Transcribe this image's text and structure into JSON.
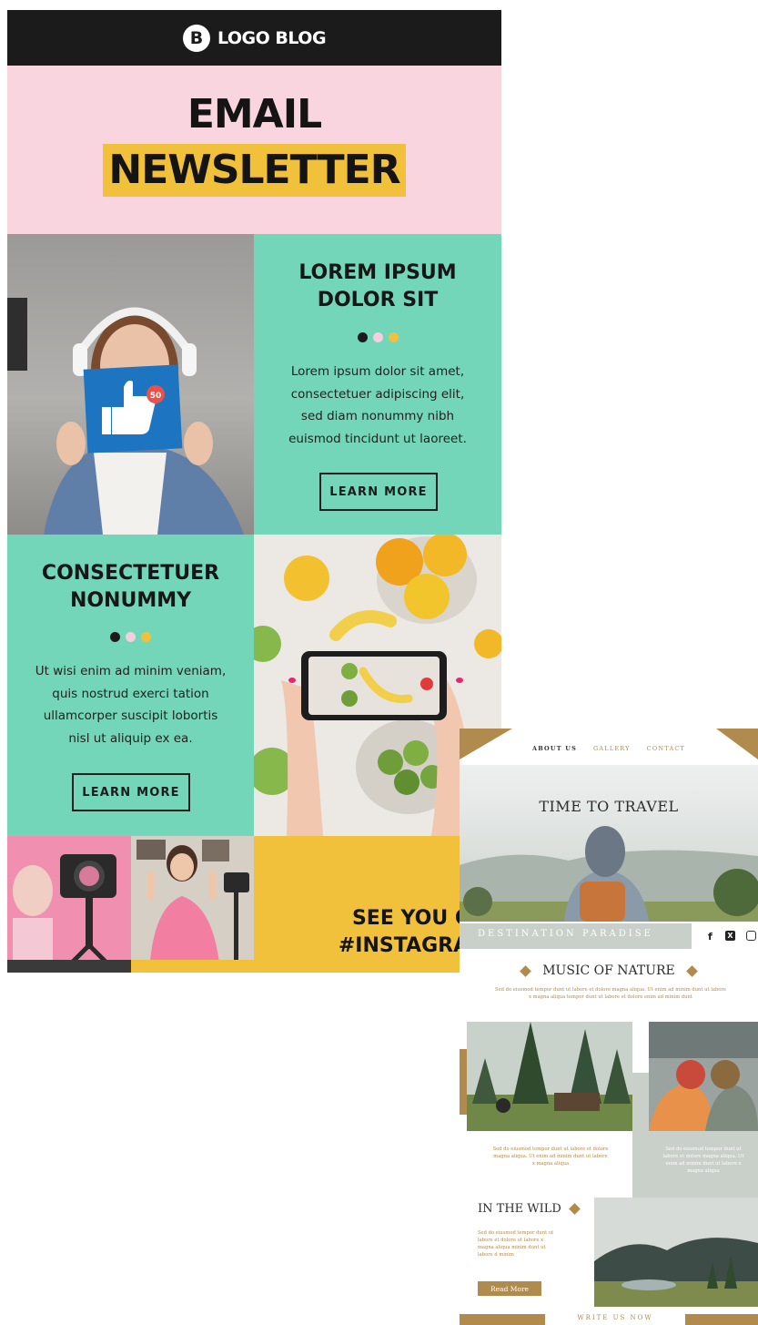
{
  "newsletter1": {
    "logo": {
      "badge": "B",
      "text": "LOGO BLOG"
    },
    "hero": {
      "line1": "EMAIL",
      "line2": "NEWSLETTER"
    },
    "block1": {
      "title_line1": "LOREM IPSUM",
      "title_line2": "DOLOR SIT",
      "body": [
        "Lorem ipsum dolor sit amet,",
        "consectetuer adipiscing elit,",
        "sed diam nonummy nibh",
        "euismod tincidunt ut laoreet."
      ],
      "button": "LEARN MORE",
      "badge_count": "50"
    },
    "block2": {
      "title_line1": "CONSECTETUER",
      "title_line2": "NONUMMY",
      "body": [
        "Ut wisi enim ad minim veniam,",
        "quis nostrud exerci tation",
        "ullamcorper suscipit lobortis",
        "nisl ut aliquip ex ea."
      ],
      "button": "LEARN MORE"
    },
    "footer": {
      "line1": "SEE YOU ON",
      "line2": "#INSTAGRAM"
    },
    "colors": {
      "dark": "#1b1b1b",
      "pink": "#f9d6df",
      "teal": "#74d6b8",
      "yellow": "#f2c13c",
      "dot_pink": "#f3d0dc"
    }
  },
  "newsletter2": {
    "nav": [
      "ABOUT US",
      "GALLERY",
      "CONTACT"
    ],
    "title": "TIME TO TRAVEL",
    "destination": "DESTINATION PARADISE",
    "social_icons": [
      "facebook-icon",
      "x-icon",
      "instagram-icon"
    ],
    "section1": {
      "title": "MUSIC OF NATURE",
      "text_line1": "Sed do eiusmod tempor dunt ut labore et dolore magna aliqua. Ut enim ad minim dunt ut labore",
      "text_line2": "x magna aliqua tempor dunt ut labore et dolore enim ad minim dunt"
    },
    "caption_left": [
      "Sed do eiusmod tempor dunt ut labore et dolore",
      "magna aliqua. Ut enim ad minim dunt ut labore",
      "x magna aliqua"
    ],
    "caption_right": [
      "Sed do eiusmod tempor dunt ut",
      "labore et dolore magna aliqua. Ut",
      "enim ad minim dunt ut labore x",
      "magna aliqua"
    ],
    "section2": {
      "title": "IN THE WILD",
      "text": [
        "Sed do eiusmod tempor dunt ut",
        "labore et dolore ut labore x",
        "magna aliqua minim dunt ut",
        "labore d minim"
      ],
      "button": "Read More"
    },
    "footer_cta": "WRITE US NOW",
    "colors": {
      "gold": "#b18b4e",
      "sage": "#c8d0c9"
    }
  }
}
